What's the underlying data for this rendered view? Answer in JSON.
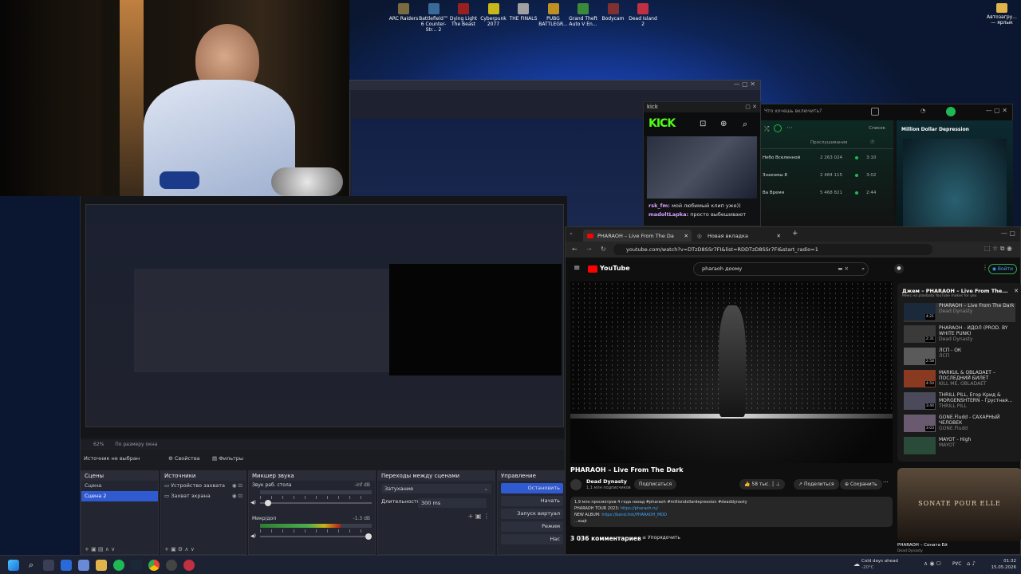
{
  "desktop": {
    "icons": [
      {
        "label": "ARC Raiders",
        "color": "#7a6a40"
      },
      {
        "label": "Battlefield™ 6 Counter-Str... 2",
        "color": "#3a6a9a"
      },
      {
        "label": "Dying Light The Beast",
        "color": "#9a2020"
      },
      {
        "label": "Cyberpunk 2077",
        "color": "#c8b818"
      },
      {
        "label": "THE FINALS",
        "color": "#a0a0a0"
      },
      {
        "label": "PUBG BATTLEGR...",
        "color": "#c09020"
      },
      {
        "label": "Grand Theft Auto V En...",
        "color": "#3a8a3a"
      },
      {
        "label": "Bodycam",
        "color": "#803030"
      },
      {
        "label": "Dead Island 2",
        "color": "#c03040"
      }
    ],
    "corner_icon_label": "Автозагру... — ярлык"
  },
  "kick": {
    "title": "kick",
    "logo": "KICK",
    "chat": [
      {
        "user": "rsk_fm:",
        "text": "мой любимый клип ужe))"
      },
      {
        "user": "madoltLapka:",
        "text": "просто выбешивают"
      }
    ]
  },
  "spotify": {
    "search": "Что хочешь включить?",
    "sort_label": "Список",
    "plays_header": "Прослушивания",
    "tracks": [
      {
        "title": "Небо Вселенной",
        "plays": "2 263 024",
        "dur": "3:10"
      },
      {
        "title": "Знакомы 8",
        "plays": "2 484 115",
        "dur": "3:02"
      },
      {
        "title": "Ва Время",
        "plays": "5 468 821",
        "dur": "2:44"
      }
    ],
    "now_playing": "Million Dollar Depression"
  },
  "obs": {
    "zoom": "62%",
    "fit": "По размеру окна",
    "source_status": "Источник не выбран",
    "props_btn": "Свойства",
    "filters_btn": "Фильтры",
    "scenes_title": "Сцены",
    "scenes": [
      "Сцена",
      "Сцена 2"
    ],
    "sources_title": "Источники",
    "sources": [
      "Устройство захвата",
      "Захват экрана"
    ],
    "mixer_title": "Микшер звука",
    "mixer": [
      {
        "name": "Звук раб. стола",
        "db": "-inf dB",
        "level": 0.0
      },
      {
        "name": "Микр/доп",
        "db": "-1.3 dB",
        "level": 0.72
      }
    ],
    "transitions_title": "Переходы между сценами",
    "transition": "Затухание",
    "duration_label": "Длительность",
    "duration": "300 ms",
    "controls_title": "Управление",
    "controls": [
      "Остановить",
      "Начать",
      "Запуск виртуал",
      "Режим",
      "Нас"
    ]
  },
  "browser": {
    "tabs": [
      "PHARAOH – Live From The Da",
      "Новая вкладка"
    ],
    "url": "youtube.com/watch?v=DTzD8SSr7FI&list=RDDTzD8SSr7FI&start_radio=1",
    "yt_logo": "YouTube",
    "search": "pharaoh доому",
    "signin": "Войти",
    "video_title": "PHARAOH – Live From The Dark",
    "channel": "Dead Dynasty",
    "subs": "1,1 млн подписчиков",
    "subscribe": "Подписаться",
    "likes": "58 тыс.",
    "share": "Поделиться",
    "save": "Сохранить",
    "desc_meta": "1,9 млн просмотров  4 года назад  #pharaoh #milliondollardepression #deaddynasty",
    "desc_tour": "PHARAOH TOUR 2023:",
    "desc_tour_link": "https://pharaoh.ru/",
    "desc_album": "NEW ALBUM:",
    "desc_album_link": "https://band.link/PHARAOH_MDD",
    "desc_more": "...ещё",
    "comments": "3 036 комментариев",
    "sort": "Упорядочить",
    "mix_title": "Джем – PHARAOH – Live From The...",
    "mix_sub": "Микс на plaxbata YouTube makes for you",
    "playlist": [
      {
        "title": "PHARAOH – Live From The Dark",
        "ch": "Dead Dynasty",
        "dur": "4:21",
        "color": "#1a2a3a"
      },
      {
        "title": "PHARAOH - ИДОЛ (PROD. BY WHITE PUNK)",
        "ch": "Dead Dynasty",
        "dur": "2:31",
        "color": "#3a3a3a"
      },
      {
        "title": "ЛСП - ОК",
        "ch": "ЛСП",
        "dur": "2:58",
        "color": "#5a5a5a"
      },
      {
        "title": "MARKUL & OBLADAET – ПОСЛЕДНИЙ БИЛЕТ",
        "ch": "KILL ME, OBLADAET",
        "dur": "4:50",
        "color": "#8a3a20"
      },
      {
        "title": "THRILL PILL, Егор Крид & MORGENSHTERN - Грустная...",
        "ch": "THRILL PILL",
        "dur": "3:44",
        "color": "#4a4a5a"
      },
      {
        "title": "GONE.Fludd - САХАРНЫЙ ЧЕЛОВЕК",
        "ch": "GONE.Fludd",
        "dur": "3:03",
        "color": "#6a5a70"
      },
      {
        "title": "MAYOT - High",
        "ch": "MAYOT",
        "dur": "",
        "color": "#2a4a3a"
      }
    ],
    "reco_title": "PHARAOH – Соната Ей",
    "reco_ch": "Dead Dynasty",
    "reco_art": "SONATE POUR ELLE"
  },
  "taskbar": {
    "weather": "Cold days ahead",
    "temp": "-20°C",
    "lang": "РУС",
    "time": "01:32",
    "date": "15.05.2026"
  }
}
